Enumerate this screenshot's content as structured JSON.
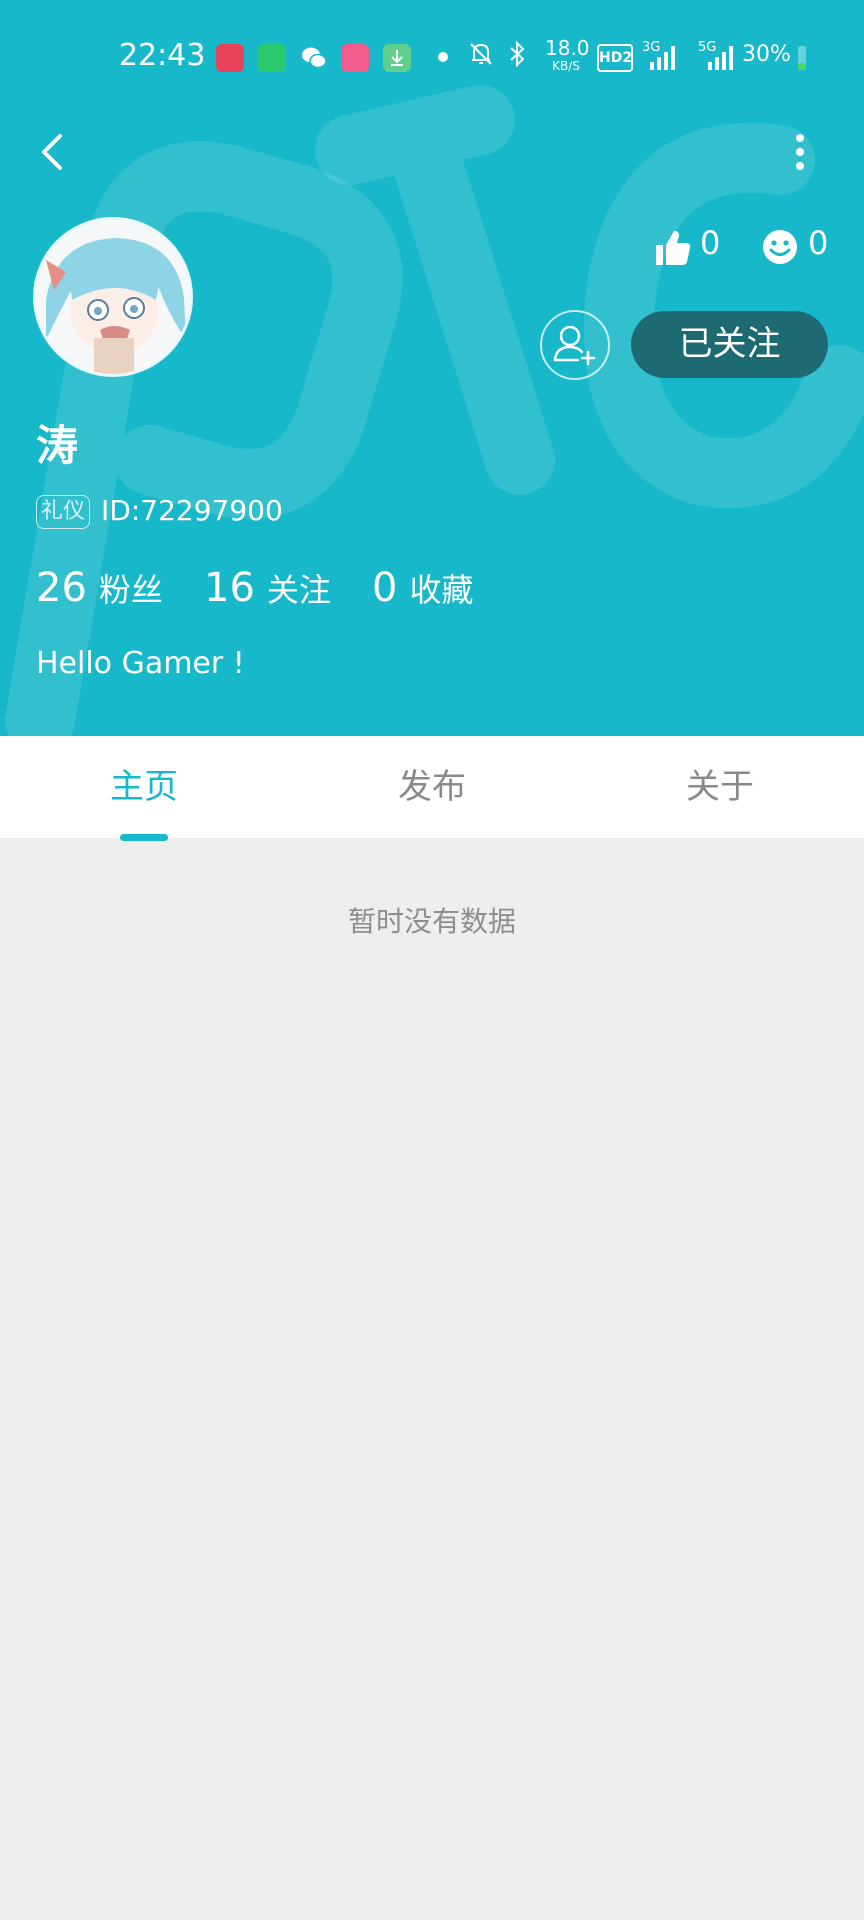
{
  "status_bar": {
    "time": "22:43",
    "speed_value": "18.0",
    "speed_unit": "KB/S",
    "hd_label": "HD2",
    "sig1_label": "3G",
    "sig2_label": "5G",
    "battery": "30%",
    "app_icons": [
      "video-app-icon",
      "shopping-app-icon",
      "wechat-icon",
      "bilibili-icon",
      "download-app-icon"
    ],
    "accent": "#16b8c9"
  },
  "profile": {
    "likes": "0",
    "emoji_count": "0",
    "followed_label": "已关注",
    "username": "涛",
    "tag": "礼仪",
    "id_text": "ID:72297900",
    "stats": [
      {
        "value": "26",
        "label": "粉丝"
      },
      {
        "value": "16",
        "label": "关注"
      },
      {
        "value": "0",
        "label": "收藏"
      }
    ],
    "bio": "Hello Gamer !"
  },
  "tabs": [
    {
      "label": "主页",
      "active": true
    },
    {
      "label": "发布",
      "active": false
    },
    {
      "label": "关于",
      "active": false
    }
  ],
  "empty_text": "暂时没有数据"
}
